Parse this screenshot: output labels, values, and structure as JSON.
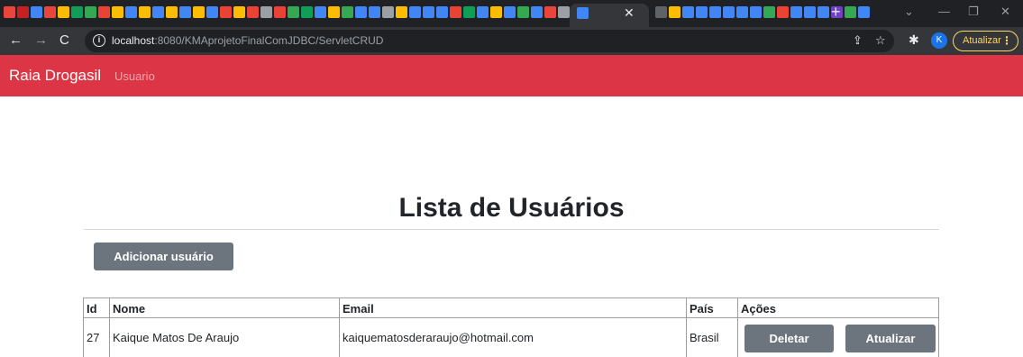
{
  "browser": {
    "url_host": "localhost",
    "url_rest": ":8080/KMAprojetoFinalComJDBC/ServletCRUD",
    "profile_initial": "K",
    "update_label": "Atualizar",
    "colors": {
      "tab_strip": "#202124",
      "toolbar": "#35363a",
      "update_accent": "#fdd663"
    }
  },
  "nav": {
    "brand": "Raia Drogasil",
    "link": "Usuario",
    "color": "#dc3545"
  },
  "main": {
    "title": "Lista de Usuários",
    "add_button": "Adicionar usuário",
    "table": {
      "headers": [
        "Id",
        "Nome",
        "Email",
        "País",
        "Ações"
      ],
      "rows": [
        {
          "id": "27",
          "nome": "Kaique Matos De Araujo",
          "email": "kaiquematosderaraujo@hotmail.com",
          "pais": "Brasil",
          "delete_label": "Deletar",
          "update_label": "Atualizar"
        }
      ]
    }
  }
}
